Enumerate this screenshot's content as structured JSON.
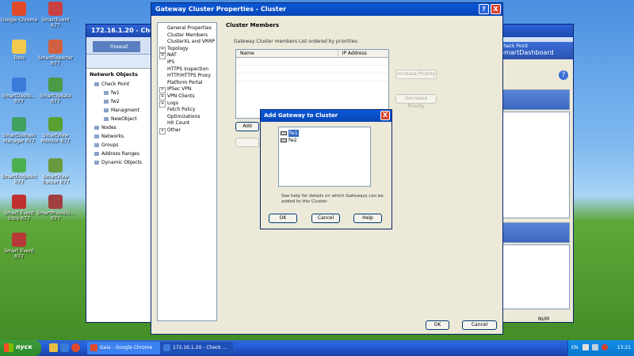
{
  "desktop": {
    "icons": [
      {
        "label": "Google Chrome",
        "color": "#e04a2a"
      },
      {
        "label": "SmartEvent R77",
        "color": "#c84040"
      },
      {
        "label": "Tools",
        "color": "#f2c94c"
      },
      {
        "label": "SmartReporter R77",
        "color": "#d06040"
      },
      {
        "label": "SmartDashb... R77",
        "color": "#3a7ad8"
      },
      {
        "label": "SmartUpdate R77",
        "color": "#4a9a48"
      },
      {
        "label": "SmartDomain Manager R77",
        "color": "#3fa060"
      },
      {
        "label": "SmartView Monitor R77",
        "color": "#58a030"
      },
      {
        "label": "SmartEndpoint R77",
        "color": "#4cb050"
      },
      {
        "label": "SmartView Tracker R77",
        "color": "#6a9a40"
      },
      {
        "label": "Smart Event Intro R77",
        "color": "#c03030"
      },
      {
        "label": "SmartProvisio... R77",
        "color": "#a04040"
      },
      {
        "label": "Smart Event R77",
        "color": "#b83838"
      }
    ]
  },
  "dashboard": {
    "title": "172.16.1.20 - Che",
    "tab_label": "Firewall",
    "tree_title": "Network Objects",
    "tree_items": [
      "Check Point",
      "fw1",
      "fw2",
      "Managment",
      "NewObject",
      "Nodes",
      "Networks",
      "Groups",
      "Address Ranges",
      "Dynamic Objects"
    ],
    "right_header_line1": "Check Point",
    "right_header_line2": "SmartDashboard",
    "status_text": "NUM"
  },
  "cluster_dialog": {
    "title": "Gateway Cluster Properties - Cluster",
    "help_btn": "?",
    "close_btn": "X",
    "nav_items": [
      {
        "label": "General Properties",
        "expand": false
      },
      {
        "label": "Cluster Members",
        "expand": false
      },
      {
        "label": "ClusterXL and VRRP",
        "expand": false
      },
      {
        "label": "Topology",
        "expand": true
      },
      {
        "label": "NAT",
        "expand": true
      },
      {
        "label": "IPS",
        "expand": false
      },
      {
        "label": "HTTPS Inspection",
        "expand": false
      },
      {
        "label": "HTTP/HTTPS Proxy",
        "expand": false
      },
      {
        "label": "Platform Portal",
        "expand": false
      },
      {
        "label": "IPSec VPN",
        "expand": true
      },
      {
        "label": "VPN Clients",
        "expand": true
      },
      {
        "label": "Logs",
        "expand": true
      },
      {
        "label": "Fetch Policy",
        "expand": false
      },
      {
        "label": "Optimizations",
        "expand": false
      },
      {
        "label": "Hit Count",
        "expand": false
      },
      {
        "label": "Other",
        "expand": true
      }
    ],
    "section_title": "Cluster Members",
    "members_label": "Gateway Cluster members List ordered by priorities:",
    "col_name": "Name",
    "col_ip": "IP Address",
    "increase_priority": "Increase Priority",
    "decrease_priority": "Decrease Priority",
    "add_btn": "Add",
    "ok_btn": "OK",
    "cancel_btn": "Cancel"
  },
  "add_gateway": {
    "title": "Add Gateway to Cluster",
    "close_btn": "X",
    "gateways": [
      {
        "name": "fw1",
        "selected": true
      },
      {
        "name": "fw2",
        "selected": false
      }
    ],
    "help_text": "See help for details on which Gateways can be added to this Cluster.",
    "ok_btn": "OK",
    "cancel_btn": "Cancel",
    "help_btn": "Help"
  },
  "taskbar": {
    "start_label": "пуск",
    "tasks": [
      {
        "label": "Gaia - Google Chrome",
        "icon_color": "#e04a2a"
      },
      {
        "label": "172.16.1.20 - Check ...",
        "icon_color": "#3a7ad8"
      }
    ],
    "lang": "EN",
    "clock": "13:21"
  }
}
